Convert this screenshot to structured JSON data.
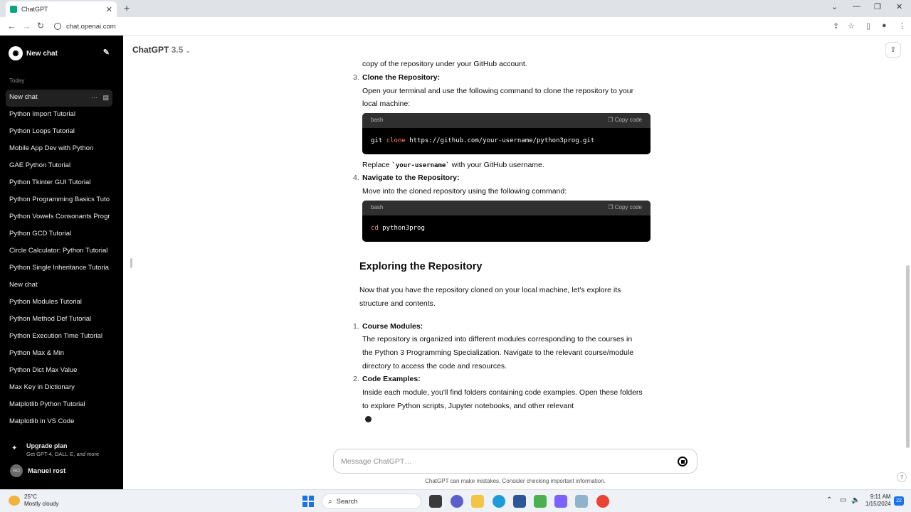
{
  "browser": {
    "tab_title": "ChatGPT",
    "tab_close": "✕",
    "new_tab": "+",
    "url": "chat.openai.com",
    "window_controls": [
      "⌄",
      "—",
      "❐",
      "✕"
    ]
  },
  "sidebar": {
    "new_chat_label": "New chat",
    "section_label": "Today",
    "items": [
      {
        "label": "New chat",
        "active": true
      },
      {
        "label": "Python Import Tutorial"
      },
      {
        "label": "Python Loops Tutorial"
      },
      {
        "label": "Mobile App Dev with Python"
      },
      {
        "label": "GAE Python Tutorial"
      },
      {
        "label": "Python Tkinter GUI Tutorial"
      },
      {
        "label": "Python Programming Basics Tuto"
      },
      {
        "label": "Python Vowels Consonants Progr"
      },
      {
        "label": "Python GCD Tutorial"
      },
      {
        "label": "Circle Calculator: Python Tutorial"
      },
      {
        "label": "Python Single Inheritance Tutoria"
      },
      {
        "label": "New chat"
      },
      {
        "label": "Python Modules Tutorial"
      },
      {
        "label": "Python Method Def Tutorial"
      },
      {
        "label": "Python Execution Time Tutorial"
      },
      {
        "label": "Python Max & Min"
      },
      {
        "label": "Python Dict Max Value"
      },
      {
        "label": "Max Key in Dictionary"
      },
      {
        "label": "Matplotlib Python Tutorial"
      },
      {
        "label": "Matplotlib in VS Code"
      }
    ],
    "upgrade_title": "Upgrade plan",
    "upgrade_subtitle": "Get GPT-4, DALL·E, and more",
    "user_initials": "RO",
    "user_name": "Manuel rost"
  },
  "header": {
    "model_name": "ChatGPT",
    "model_version": "3.5"
  },
  "message": {
    "line_top": "copy of the repository under your GitHub account.",
    "step3_num": "3.",
    "step3_title": "Clone the Repository:",
    "step3_text1": "Open your terminal and use the following command to clone the repository to your",
    "step3_text2": "local machine:",
    "code1_lang": "bash",
    "copy_label": "Copy code",
    "code1_cmd": "git",
    "code1_kw": "clone",
    "code1_arg": "https://github.com/your-username/python3prog.git",
    "replace_pre": "Replace ",
    "replace_code": "`your-username`",
    "replace_post": " with your GitHub username.",
    "step4_num": "4.",
    "step4_title": "Navigate to the Repository:",
    "step4_text": "Move into the cloned repository using the following command:",
    "code2_lang": "bash",
    "code2_kw": "cd",
    "code2_arg": "python3prog",
    "heading": "Exploring the Repository",
    "intro1": "Now that you have the repository cloned on your local machine, let's explore its",
    "intro2": "structure and contents.",
    "item1_num": "1.",
    "item1_title": "Course Modules:",
    "item1_text1": "The repository is organized into different modules corresponding to the courses in",
    "item1_text2": "the Python 3 Programming Specialization. Navigate to the relevant course/module",
    "item1_text3": "directory to access the code and resources.",
    "item2_num": "2.",
    "item2_title": "Code Examples:",
    "item2_text1": "Inside each module, you'll find folders containing code examples. Open these folders",
    "item2_text2": "to explore Python scripts, Jupyter notebooks, and other relevant"
  },
  "composer": {
    "placeholder": "Message ChatGPT…",
    "disclaimer": "ChatGPT can make mistakes. Consider checking important information."
  },
  "taskbar": {
    "temperature": "25°C",
    "weather": "Mostly cloudy",
    "search_label": "Search",
    "time": "9:11 AM",
    "date": "1/15/2024",
    "notifications": "22"
  },
  "colors": {
    "sidebar_bg": "#000000",
    "code_bg": "#000000",
    "keyword": "#ff8a65",
    "accent": "#10a37f"
  }
}
